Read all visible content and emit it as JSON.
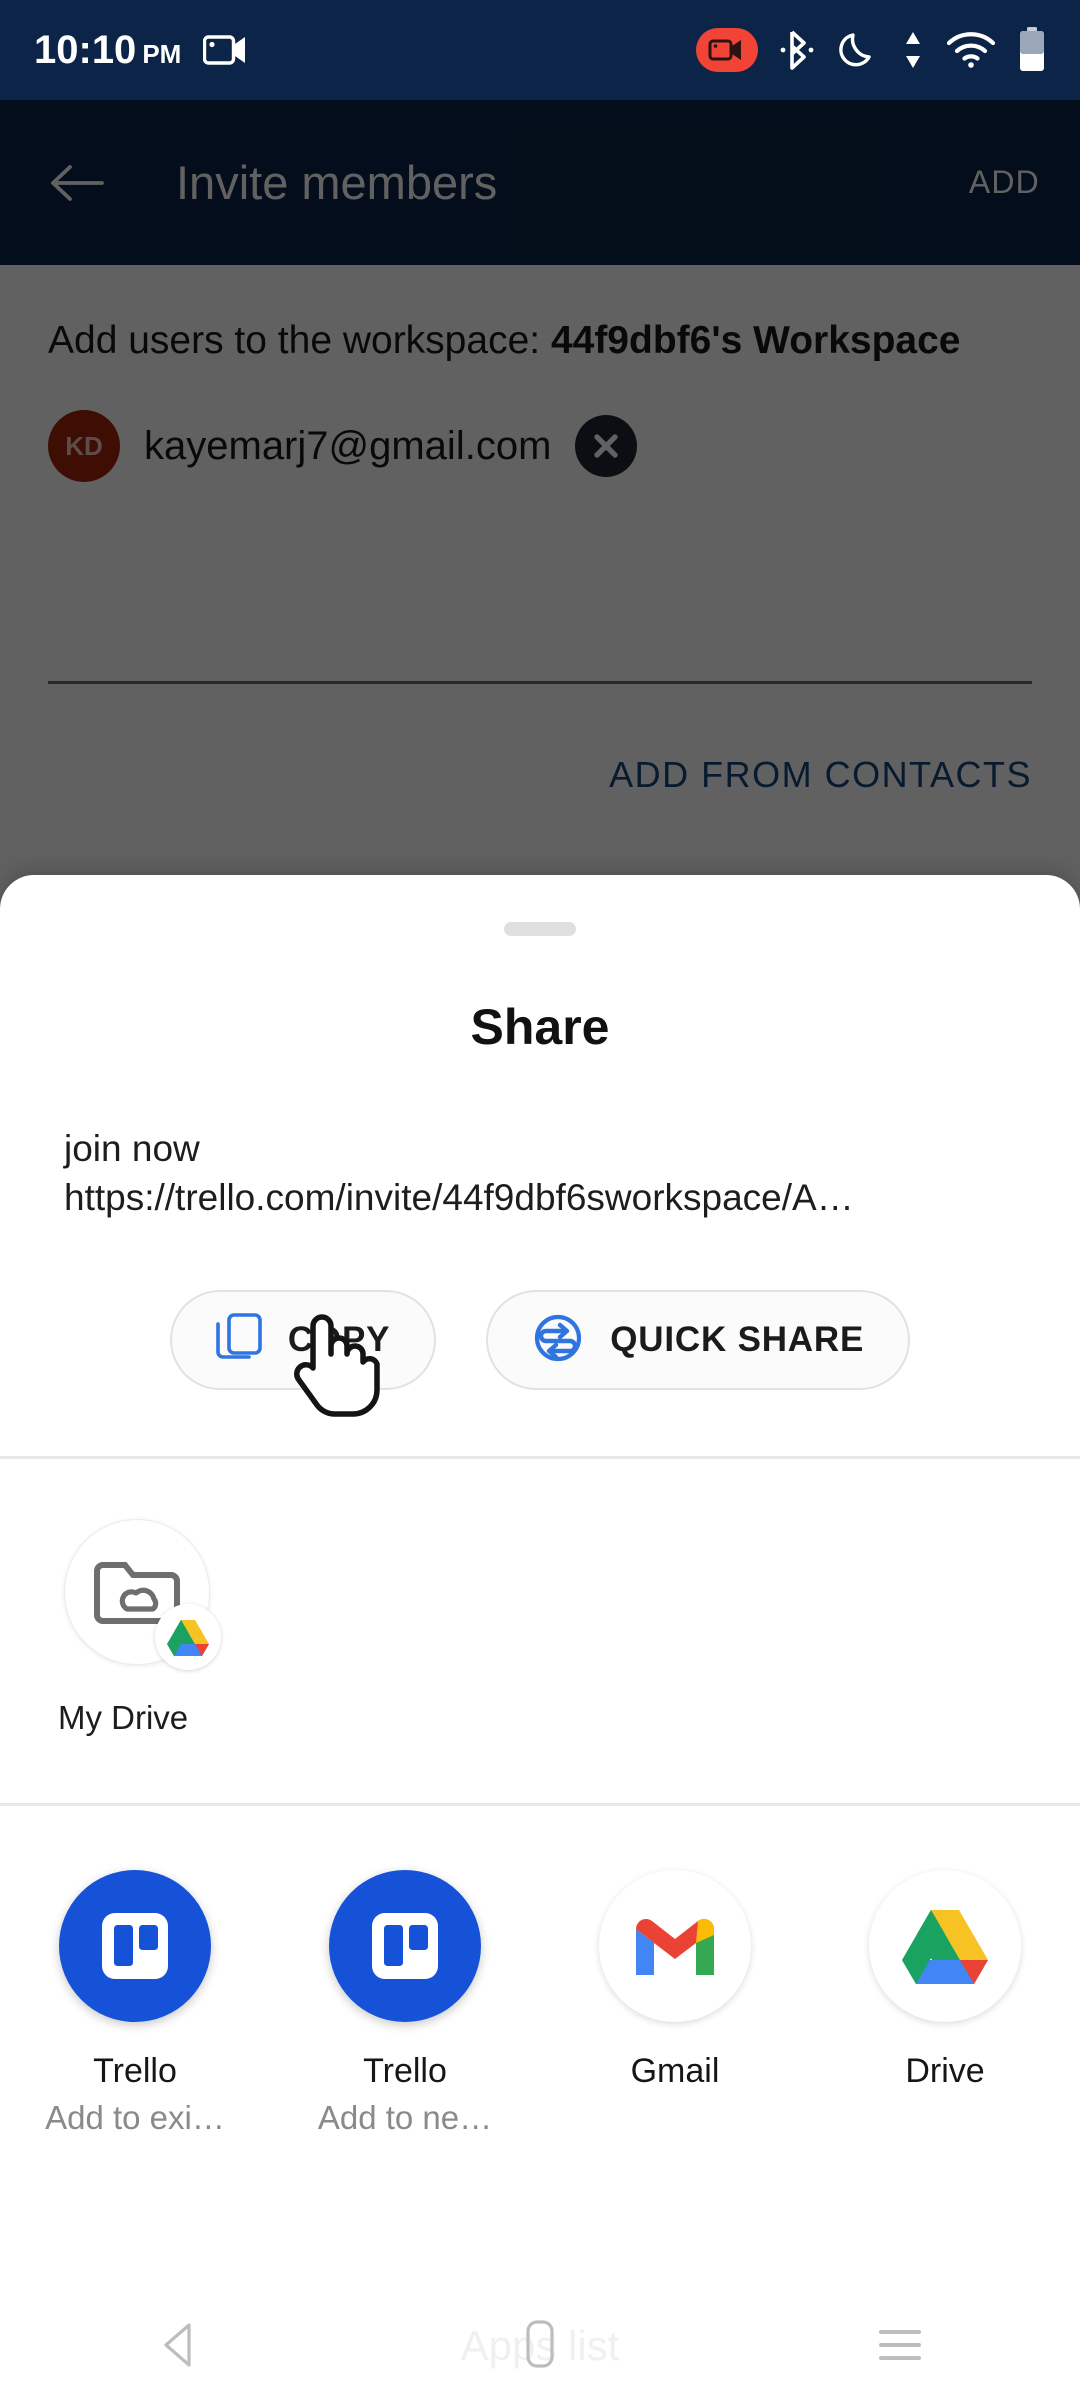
{
  "status_bar": {
    "time": "10:10",
    "ampm": "PM",
    "icons": [
      "screen-record-icon",
      "bluetooth-icon",
      "do-not-disturb-moon-icon",
      "data-transfer-icon",
      "wifi-icon",
      "battery-icon"
    ]
  },
  "app_bar": {
    "back_icon": "back-arrow-icon",
    "title": "Invite members",
    "action_label": "ADD"
  },
  "invite_screen": {
    "prompt_prefix": "Add users to the workspace: ",
    "workspace_name": "44f9dbf6's Workspace",
    "chip": {
      "initials": "KD",
      "email": "kayemarj7@gmail.com",
      "remove_icon": "close-circle-icon"
    },
    "input_placeholder": "",
    "input_value": "",
    "contacts_link": "ADD FROM CONTACTS"
  },
  "share_sheet": {
    "title": "Share",
    "preview_line1": "join now",
    "preview_line2": "https://trello.com/invite/44f9dbf6sworkspace/A…",
    "actions": [
      {
        "label": "COPY",
        "icon": "copy-icon"
      },
      {
        "label": "QUICK SHARE",
        "icon": "quick-share-icon"
      }
    ],
    "drive_shortcut": {
      "label": "My Drive",
      "icon": "folder-cloud-icon",
      "badge_icon": "google-drive-icon"
    },
    "apps": [
      {
        "name": "Trello",
        "subtitle": "Add to exi…",
        "icon": "trello-icon"
      },
      {
        "name": "Trello",
        "subtitle": "Add to ne…",
        "icon": "trello-icon"
      },
      {
        "name": "Gmail",
        "subtitle": "",
        "icon": "gmail-icon"
      },
      {
        "name": "Drive",
        "subtitle": "",
        "icon": "google-drive-icon"
      }
    ]
  },
  "nav_bar": {
    "ghost_label": "Apps list",
    "back_icon": "nav-back-icon",
    "home_icon": "nav-home-icon",
    "recents_icon": "nav-recents-icon"
  },
  "colors": {
    "app_bar": "#0b2447",
    "link_blue": "#14457e",
    "trello_blue": "#1552d8",
    "accent_blue": "#2f74df",
    "avatar_red": "#a3270f",
    "record_red": "#f24436"
  }
}
